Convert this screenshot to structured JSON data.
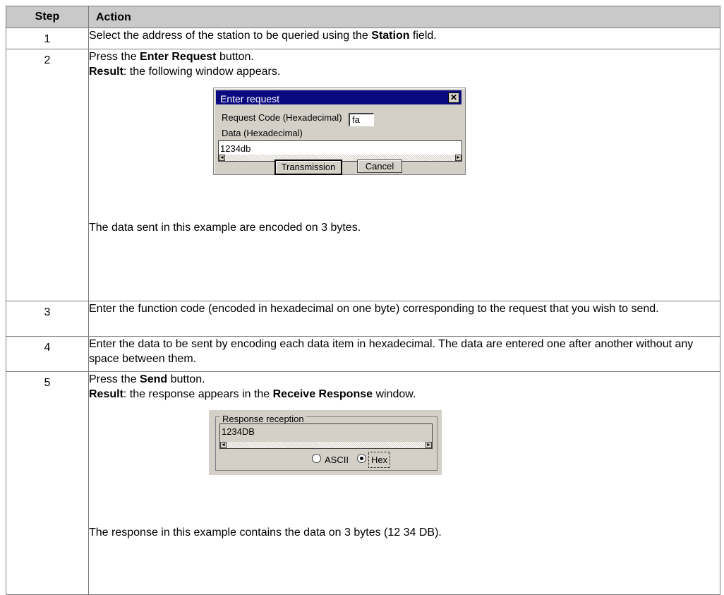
{
  "table": {
    "header": {
      "step": "Step",
      "action": "Action"
    },
    "rows": [
      {
        "step": "1",
        "segs": [
          "Select the address of the station to be queried using the ",
          "Station",
          " field."
        ]
      },
      {
        "step": "2",
        "line1": [
          "Press the ",
          "Enter Request",
          " button."
        ],
        "line2": [
          "Result",
          ": the following window appears."
        ],
        "after": "The data sent in this example are encoded on 3 bytes."
      },
      {
        "step": "3",
        "text": "Enter the function code (encoded in hexadecimal on one byte) corresponding to the request that you wish to send."
      },
      {
        "step": "4",
        "text": "Enter the data to be sent by encoding each data item in hexadecimal. The data are entered one after another without any space between them."
      },
      {
        "step": "5",
        "line1": [
          "Press the ",
          "Send",
          " button."
        ],
        "line2": [
          "Result",
          ": the response appears in the ",
          "Receive Response",
          " window."
        ],
        "after": "The response in this example contains the data on 3 bytes (12 34 DB)."
      }
    ]
  },
  "dialog": {
    "title": "Enter request",
    "close_glyph": "✕",
    "code_label": "Request Code (Hexadecimal)",
    "code_value": "fa",
    "data_label": "Data (Hexadecimal)",
    "data_value": "1234db",
    "transmission_label": "Transmission",
    "cancel_label": "Cancel"
  },
  "response_panel": {
    "legend": "Response reception",
    "value": "1234DB",
    "ascii_label": "ASCII",
    "hex_label": "Hex",
    "selected": "Hex"
  },
  "icons": {
    "scroll_left": "◄",
    "scroll_right": "►"
  }
}
